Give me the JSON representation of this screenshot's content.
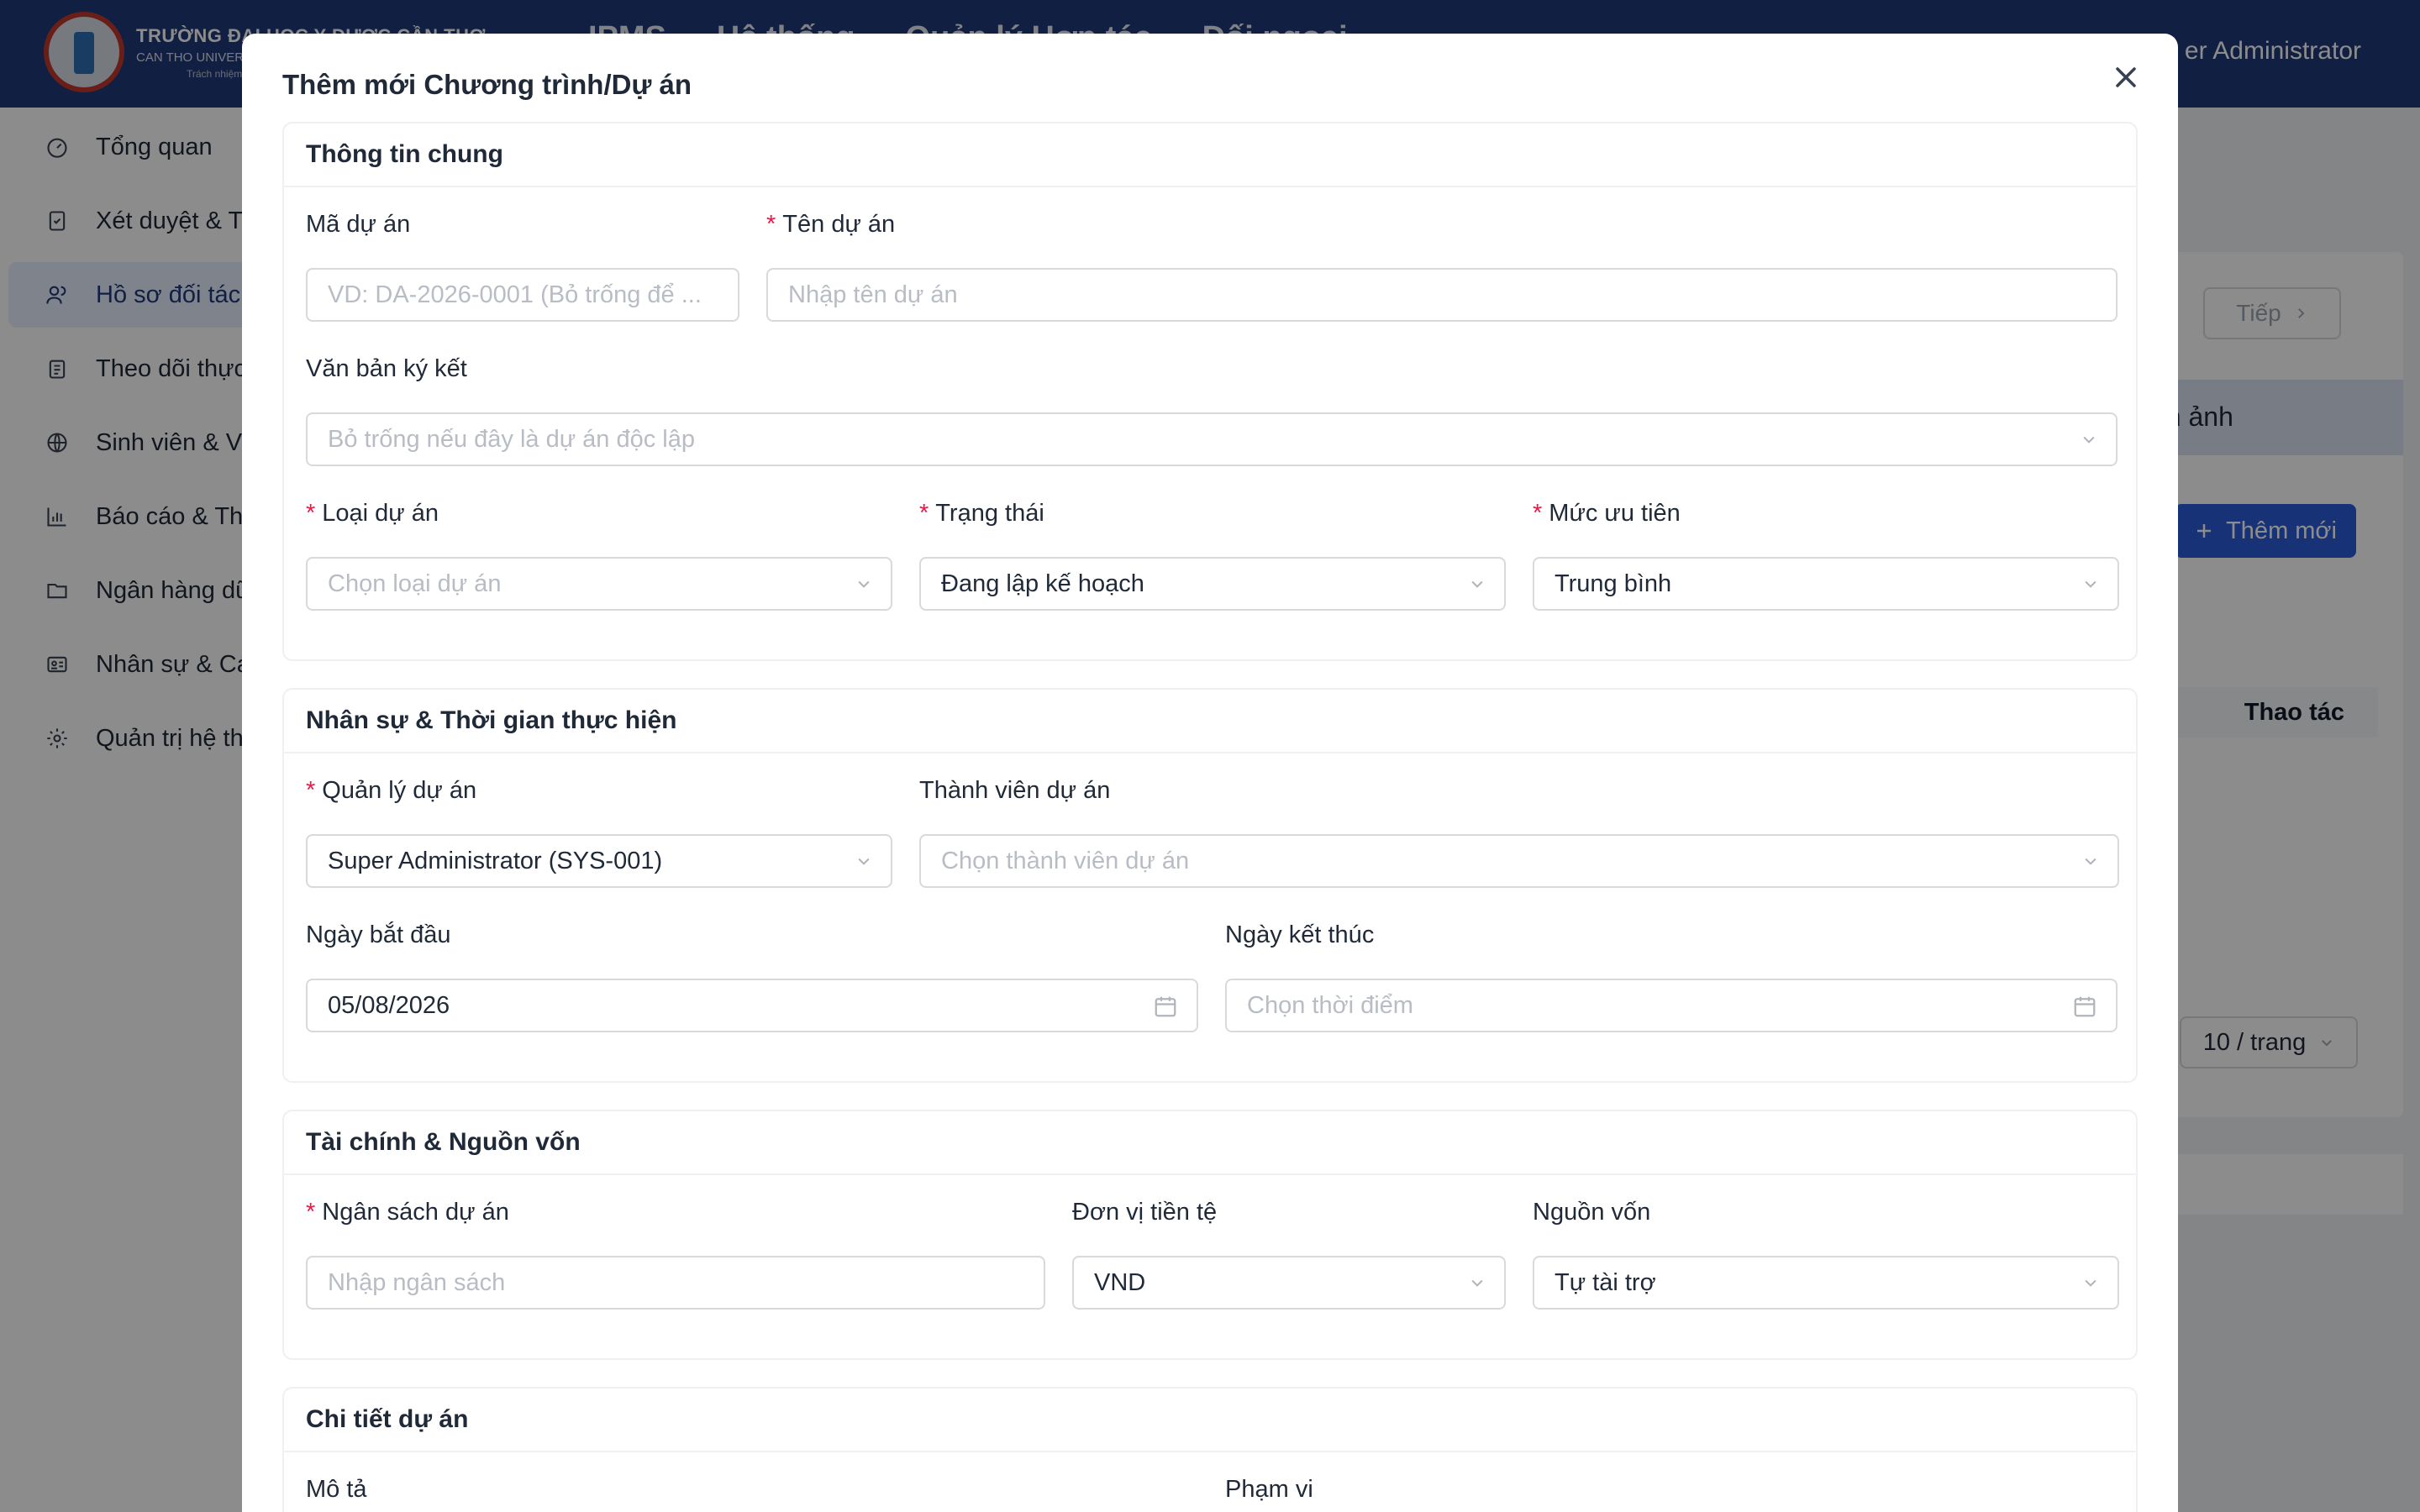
{
  "app": {
    "logo_title": "TRƯỜNG ĐẠI HỌC Y DƯỢC CẦN THƠ",
    "logo_sub": "CAN THO UNIVERSITY",
    "logo_motto": "Trách nhiệm · C",
    "top_nav": [
      "IPMS",
      "Hệ thống",
      "Quản lý Hợp tác",
      "Đối ngoại"
    ],
    "user_name": "er Administrator"
  },
  "sidebar": {
    "items": [
      {
        "label": "Tổng quan",
        "icon": "dashboard-icon"
      },
      {
        "label": "Xét duyệt & T",
        "icon": "document-check-icon"
      },
      {
        "label": "Hồ sơ đối tác",
        "icon": "users-icon"
      },
      {
        "label": "Theo dõi thực",
        "icon": "clipboard-icon"
      },
      {
        "label": "Sinh viên & Vis",
        "icon": "globe-icon"
      },
      {
        "label": "Báo cáo & Thố",
        "icon": "bar-chart-icon"
      },
      {
        "label": "Ngân hàng dữ",
        "icon": "folder-icon"
      },
      {
        "label": "Nhân sự & Cán",
        "icon": "id-card-icon"
      },
      {
        "label": "Quản trị hệ thố",
        "icon": "gear-icon"
      }
    ],
    "active_index": 2
  },
  "background": {
    "next_label": "Tiếp",
    "tab_text": "nh ảnh",
    "add_button": "Thêm mới",
    "action_header": "Thao tác",
    "page_size": "10 / trang"
  },
  "modal": {
    "title": "Thêm mới Chương trình/Dự án",
    "sections": {
      "general": {
        "title": "Thông tin chung",
        "ma_du_an": {
          "label": "Mã dự án",
          "placeholder": "VD: DA-2026-0001 (Bỏ trống để ..."
        },
        "ten_du_an": {
          "label": "Tên dự án",
          "placeholder": "Nhập tên dự án"
        },
        "van_ban": {
          "label": "Văn bản ký kết",
          "placeholder": "Bỏ trống nếu đây là dự án độc lập"
        },
        "loai_du_an": {
          "label": "Loại dự án",
          "placeholder": "Chọn loại dự án"
        },
        "trang_thai": {
          "label": "Trạng thái",
          "value": "Đang lập kế hoạch"
        },
        "muc_uu_tien": {
          "label": "Mức ưu tiên",
          "value": "Trung bình"
        }
      },
      "staff": {
        "title": "Nhân sự & Thời gian thực hiện",
        "quan_ly": {
          "label": "Quản lý dự án",
          "value": "Super Administrator (SYS-001)"
        },
        "thanh_vien": {
          "label": "Thành viên dự án",
          "placeholder": "Chọn thành viên dự án"
        },
        "ngay_bat_dau": {
          "label": "Ngày bắt đầu",
          "value": "05/08/2026"
        },
        "ngay_ket_thuc": {
          "label": "Ngày kết thúc",
          "placeholder": "Chọn thời điểm"
        }
      },
      "finance": {
        "title": "Tài chính & Nguồn vốn",
        "ngan_sach": {
          "label": "Ngân sách dự án",
          "placeholder": "Nhập ngân sách"
        },
        "don_vi": {
          "label": "Đơn vị tiền tệ",
          "value": "VND"
        },
        "nguon_von": {
          "label": "Nguồn vốn",
          "value": "Tự tài trợ"
        }
      },
      "detail": {
        "title": "Chi tiết dự án",
        "mo_ta": {
          "label": "Mô tả"
        },
        "pham_vi": {
          "label": "Phạm vi"
        }
      }
    }
  },
  "colors": {
    "topbar": "#1f3a7a",
    "required": "#e11d48",
    "primary": "#2b5bd7"
  }
}
